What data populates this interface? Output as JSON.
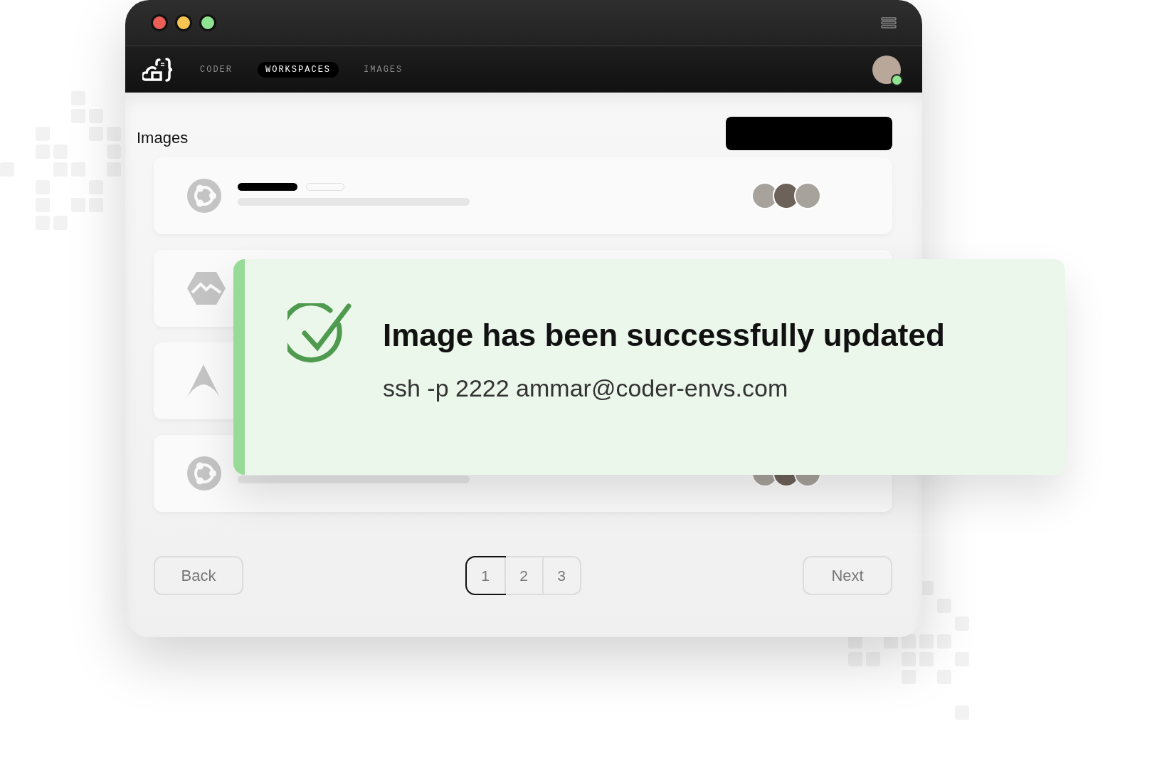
{
  "window": {
    "traffic_lights": [
      {
        "color": "#ec5f57"
      },
      {
        "color": "#f5c451"
      },
      {
        "color": "#8fe290"
      }
    ]
  },
  "nav": {
    "tabs": [
      {
        "label": "CODER",
        "selected": false
      },
      {
        "label": "WORKSPACES",
        "selected": true
      },
      {
        "label": "IMAGES",
        "selected": false
      }
    ],
    "user": {
      "online": true
    }
  },
  "page": {
    "title": "Images"
  },
  "rows": [
    {
      "kind": "ubuntu"
    },
    {
      "kind": "alpine"
    },
    {
      "kind": "arch"
    },
    {
      "kind": "ubuntu"
    }
  ],
  "toast": {
    "title": "Image has been successfully updated",
    "message": "ssh -p 2222 ammar@coder-envs.com"
  },
  "pagination": {
    "back": "Back",
    "next": "Next",
    "pages": [
      {
        "label": "1",
        "selected": true
      },
      {
        "label": "2",
        "selected": false
      },
      {
        "label": "3",
        "selected": false
      }
    ]
  }
}
